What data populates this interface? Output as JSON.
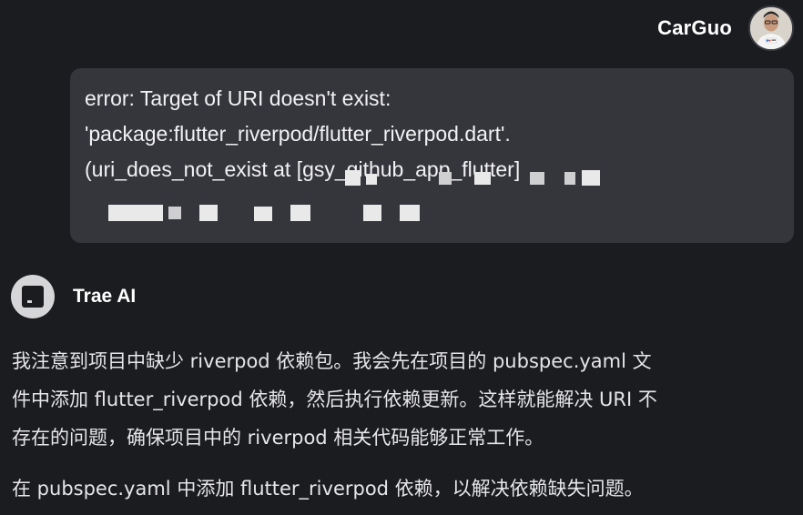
{
  "user": {
    "name": "CarGuo",
    "avatar_icon": "person-avatar-icon"
  },
  "user_message": {
    "lines": [
      "error: Target of URI doesn't exist:",
      "'package:flutter_riverpod/flutter_riverpod.dart'.",
      "(uri_does_not_exist at [gsy_github_app_flutter]"
    ]
  },
  "assistant": {
    "name": "Trae AI",
    "avatar_icon": "trae-logo-icon",
    "reply_lines": [
      "我注意到项目中缺少 riverpod 依赖包。我会先在项目的 pubspec.yaml 文",
      "件中添加 flutter_riverpod 依赖，然后执行依赖更新。这样就能解决 URI 不",
      "存在的问题，确保项目中的 riverpod 相关代码能够正常工作。"
    ],
    "second_paragraph": "在 pubspec.yaml 中添加 flutter_riverpod 依赖，以解决依赖缺失问题。"
  },
  "colors": {
    "background": "#1b1c20",
    "bubble": "#35363c",
    "text": "#e9e9ec",
    "redaction": "#e9e9ea"
  }
}
